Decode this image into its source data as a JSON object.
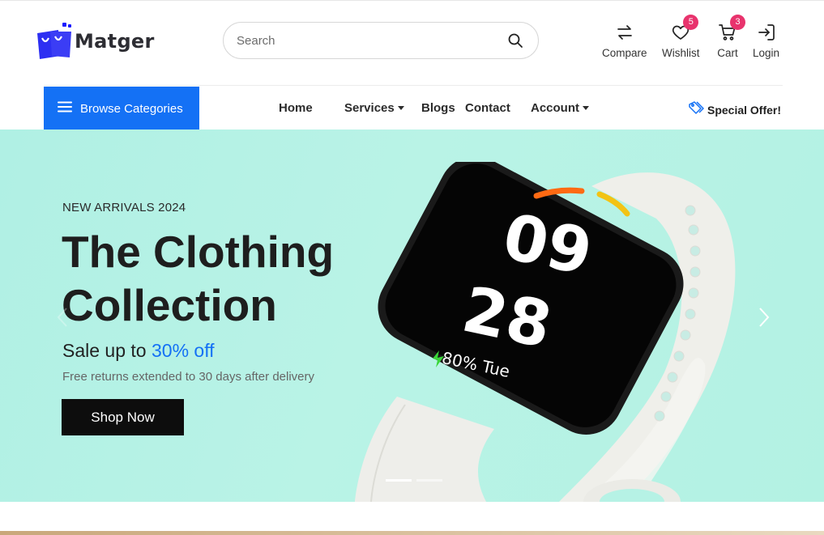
{
  "header": {
    "brand": "Matger",
    "search": {
      "placeholder": "Search",
      "value": ""
    },
    "actions": {
      "compare": {
        "label": "Compare"
      },
      "wishlist": {
        "label": "Wishlist",
        "count": "5"
      },
      "cart": {
        "label": "Cart",
        "count": "3"
      },
      "login": {
        "label": "Login"
      }
    }
  },
  "nav": {
    "browse_label": "Browse Categories",
    "items": [
      {
        "label": "Home"
      },
      {
        "label": "Services"
      },
      {
        "label": "Blogs"
      },
      {
        "label": "Contact"
      },
      {
        "label": "Account"
      }
    ],
    "special_offer": "Special Offer!"
  },
  "hero": {
    "eyebrow": "NEW ARRIVALS 2024",
    "headline_line1": "The Clothing",
    "headline_line2": "Collection",
    "sale_prefix": "Sale up to",
    "sale_highlight": "30% off",
    "subtext": "Free returns extended to 30 days after delivery",
    "cta_label": "Shop Now",
    "watch_hours": "09",
    "watch_minutes": "28",
    "watch_status": "80% Tue",
    "slide_indicators": {
      "count": 2,
      "active_index": 0
    }
  },
  "colors": {
    "accent": "#1471f5",
    "badge": "#e8336d",
    "hero_bg": "#b6f2e5",
    "cta_bg": "#0d0d0d"
  },
  "icons": {
    "logo": "shopping-bags-logo",
    "search": "search-icon",
    "compare": "compare-arrows-icon",
    "wishlist": "heart-icon",
    "cart": "cart-icon",
    "login": "login-icon",
    "menu": "hamburger-icon",
    "special": "tag-icon"
  }
}
